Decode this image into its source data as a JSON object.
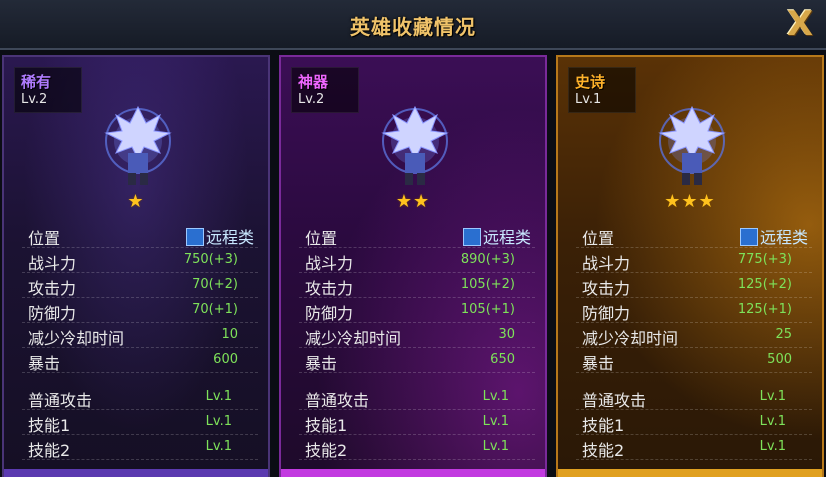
{
  "window": {
    "title": "英雄收藏情况",
    "close_label": "X"
  },
  "labels": {
    "position": "位置",
    "power": "战斗力",
    "attack": "攻击力",
    "defense": "防御力",
    "cooldown": "减少冷却时间",
    "crit": "暴击",
    "normal_attack": "普通攻击",
    "skill1": "技能1",
    "skill2": "技能2"
  },
  "cards": [
    {
      "rarity": "稀有",
      "level": "Lv.2",
      "stars": "★",
      "class": "远程类",
      "power": "750(+3)",
      "attack": "70(+2)",
      "defense": "70(+1)",
      "cooldown": "10",
      "crit": "600",
      "normal_attack_lv": "Lv.1",
      "skill1_lv": "Lv.1",
      "skill2_lv": "Lv.1"
    },
    {
      "rarity": "神器",
      "level": "Lv.2",
      "stars": "★★",
      "class": "远程类",
      "power": "890(+3)",
      "attack": "105(+2)",
      "defense": "105(+1)",
      "cooldown": "30",
      "crit": "650",
      "normal_attack_lv": "Lv.1",
      "skill1_lv": "Lv.1",
      "skill2_lv": "Lv.1"
    },
    {
      "rarity": "史诗",
      "level": "Lv.1",
      "stars": "★★★",
      "class": "远程类",
      "power": "775(+3)",
      "attack": "125(+2)",
      "defense": "125(+1)",
      "cooldown": "25",
      "crit": "500",
      "normal_attack_lv": "Lv.1",
      "skill1_lv": "Lv.1",
      "skill2_lv": "Lv.1"
    }
  ],
  "icons": {
    "hero": "blue-spiky-hair-archer-sprite",
    "class": "bow-icon",
    "close": "close-icon",
    "star": "star-icon"
  },
  "colors": {
    "title": "#f0c36a",
    "value_green": "#7ee25a",
    "rare": "#b07cff",
    "artifact": "#ee66ff",
    "epic": "#ffb22a"
  }
}
